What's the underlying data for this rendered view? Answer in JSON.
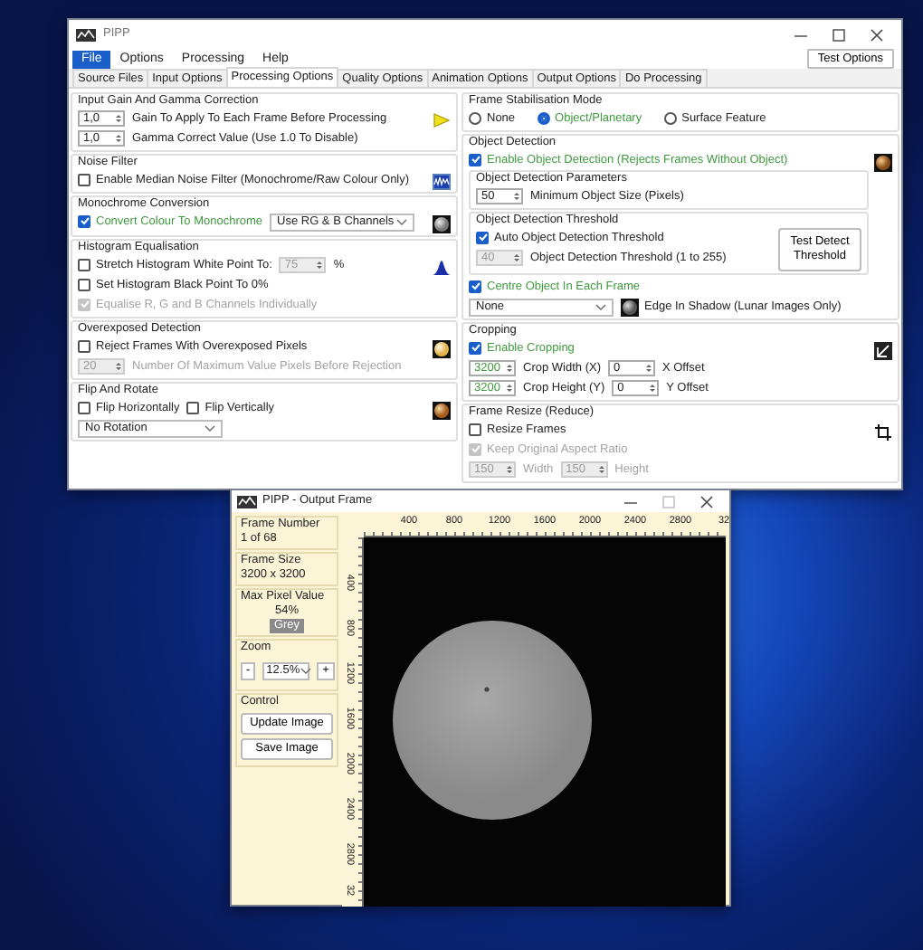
{
  "main_window": {
    "title": "PIPP",
    "menu": [
      {
        "label": "File",
        "selected": true
      },
      {
        "label": "Options",
        "selected": false
      },
      {
        "label": "Processing",
        "selected": false
      },
      {
        "label": "Help",
        "selected": false
      }
    ],
    "test_options_button": "Test Options",
    "tabs": [
      {
        "label": "Source Files",
        "selected": false
      },
      {
        "label": "Input Options",
        "selected": false
      },
      {
        "label": "Processing Options",
        "selected": true
      },
      {
        "label": "Quality Options",
        "selected": false
      },
      {
        "label": "Animation Options",
        "selected": false
      },
      {
        "label": "Output Options",
        "selected": false
      },
      {
        "label": "Do Processing",
        "selected": false
      }
    ],
    "left_sections": [
      {
        "title": "Input Gain And Gamma Correction",
        "rows": [
          {
            "kind": "line",
            "items": [
              {
                "kind": "spin",
                "value": "1,0",
                "disabled": false,
                "emphasized": false
              },
              {
                "kind": "text",
                "text": "Gain To Apply To Each Frame Before Processing",
                "disabled": false
              }
            ]
          },
          {
            "kind": "line",
            "items": [
              {
                "kind": "spin",
                "value": "1,0",
                "disabled": false,
                "emphasized": false
              },
              {
                "kind": "text",
                "text": "Gamma Correct Value (Use 1.0 To Disable)",
                "disabled": false
              }
            ]
          }
        ]
      },
      {
        "title": "Noise Filter",
        "rows": [
          {
            "kind": "line",
            "items": [
              {
                "kind": "checkbox",
                "label": "Enable Median Noise Filter (Monochrome/Raw Colour Only)",
                "checked": false,
                "disabled": false,
                "emphasized": false
              }
            ]
          }
        ]
      },
      {
        "title": "Monochrome Conversion",
        "rows": [
          {
            "kind": "line",
            "items": [
              {
                "kind": "checkbox",
                "label": "Convert Colour To Monochrome",
                "checked": true,
                "disabled": false,
                "emphasized": true
              },
              {
                "kind": "select",
                "value": "Use RG & B Channels"
              }
            ]
          }
        ]
      },
      {
        "title": "Histogram Equalisation",
        "rows": [
          {
            "kind": "line",
            "items": [
              {
                "kind": "checkbox",
                "label": "Stretch Histogram White Point To:",
                "checked": false,
                "disabled": false,
                "emphasized": false
              },
              {
                "kind": "spin",
                "value": "75",
                "disabled": true,
                "emphasized": false
              },
              {
                "kind": "text",
                "text": "%",
                "disabled": false
              }
            ]
          },
          {
            "kind": "line",
            "items": [
              {
                "kind": "checkbox",
                "label": "Set Histogram Black Point To 0%",
                "checked": false,
                "disabled": false,
                "emphasized": false
              }
            ]
          },
          {
            "kind": "line",
            "items": [
              {
                "kind": "checkbox",
                "label": "Equalise R, G and B Channels Individually",
                "checked": true,
                "disabled": true,
                "emphasized": false
              }
            ]
          }
        ]
      },
      {
        "title": "Overexposed Detection",
        "rows": [
          {
            "kind": "line",
            "items": [
              {
                "kind": "checkbox",
                "label": "Reject Frames With Overexposed Pixels",
                "checked": false,
                "disabled": false,
                "emphasized": false
              }
            ]
          },
          {
            "kind": "line",
            "items": [
              {
                "kind": "spin",
                "value": "20",
                "disabled": true,
                "emphasized": false
              },
              {
                "kind": "text",
                "text": "Number Of Maximum Value Pixels Before Rejection",
                "disabled": true
              }
            ]
          }
        ]
      },
      {
        "title": "Flip And Rotate",
        "rows": [
          {
            "kind": "line",
            "items": [
              {
                "kind": "checkbox",
                "label": "Flip Horizontally",
                "checked": false,
                "disabled": false,
                "emphasized": false
              },
              {
                "kind": "checkbox",
                "label": "Flip Vertically",
                "checked": false,
                "disabled": false,
                "emphasized": false
              }
            ]
          },
          {
            "kind": "line",
            "items": [
              {
                "kind": "select",
                "value": "No Rotation"
              }
            ]
          }
        ]
      }
    ],
    "right_sections": [
      {
        "title": "Frame Stabilisation Mode",
        "rows": [
          {
            "kind": "line",
            "items": [
              {
                "kind": "radio",
                "label": "None",
                "selected": false
              },
              {
                "kind": "radio",
                "label": "Object/Planetary",
                "selected": true
              },
              {
                "kind": "radio",
                "label": "Surface Feature",
                "selected": false
              }
            ]
          }
        ]
      },
      {
        "title": "Object Detection",
        "rows": [
          {
            "kind": "line",
            "items": [
              {
                "kind": "checkbox",
                "label": "Enable Object Detection (Rejects Frames Without Object)",
                "checked": true,
                "disabled": false,
                "emphasized": true
              }
            ]
          },
          {
            "kind": "group",
            "title": "Object Detection Parameters",
            "rows": [
              {
                "kind": "line",
                "items": [
                  {
                    "kind": "spin",
                    "value": "50",
                    "disabled": false,
                    "emphasized": false
                  },
                  {
                    "kind": "text",
                    "text": "Minimum Object Size (Pixels)",
                    "disabled": false
                  }
                ]
              }
            ]
          },
          {
            "kind": "group",
            "title": "Object Detection Threshold",
            "button": "Test Detect Threshold",
            "rows": [
              {
                "kind": "line",
                "items": [
                  {
                    "kind": "checkbox",
                    "label": "Auto Object Detection Threshold",
                    "checked": true,
                    "disabled": false,
                    "emphasized": false
                  }
                ]
              },
              {
                "kind": "line",
                "items": [
                  {
                    "kind": "spin",
                    "value": "40",
                    "disabled": true,
                    "emphasized": false
                  },
                  {
                    "kind": "text",
                    "text": "Object Detection Threshold (1 to 255)",
                    "disabled": false
                  }
                ]
              }
            ]
          },
          {
            "kind": "line",
            "items": [
              {
                "kind": "checkbox",
                "label": "Centre Object In Each Frame",
                "checked": true,
                "disabled": false,
                "emphasized": true
              }
            ]
          },
          {
            "kind": "line",
            "items": [
              {
                "kind": "select",
                "value": "None"
              },
              {
                "kind": "icon_text",
                "text": "Edge In Shadow (Lunar Images Only)"
              }
            ]
          }
        ]
      },
      {
        "title": "Cropping",
        "rows": [
          {
            "kind": "line",
            "items": [
              {
                "kind": "checkbox",
                "label": "Enable Cropping",
                "checked": true,
                "disabled": false,
                "emphasized": true
              }
            ]
          },
          {
            "kind": "line",
            "items": [
              {
                "kind": "spin",
                "value": "3200",
                "disabled": false,
                "emphasized": true
              },
              {
                "kind": "text",
                "text": "Crop Width (X)",
                "disabled": false
              },
              {
                "kind": "spin",
                "value": "0",
                "disabled": false,
                "emphasized": false
              },
              {
                "kind": "text",
                "text": "X Offset",
                "disabled": false
              }
            ]
          },
          {
            "kind": "line",
            "items": [
              {
                "kind": "spin",
                "value": "3200",
                "disabled": false,
                "emphasized": true
              },
              {
                "kind": "text",
                "text": "Crop Height (Y)",
                "disabled": false
              },
              {
                "kind": "spin",
                "value": "0",
                "disabled": false,
                "emphasized": false
              },
              {
                "kind": "text",
                "text": "Y Offset",
                "disabled": false
              }
            ]
          }
        ]
      },
      {
        "title": "Frame Resize (Reduce)",
        "rows": [
          {
            "kind": "line",
            "items": [
              {
                "kind": "checkbox",
                "label": "Resize Frames",
                "checked": false,
                "disabled": false,
                "emphasized": false
              }
            ]
          },
          {
            "kind": "line",
            "items": [
              {
                "kind": "checkbox",
                "label": "Keep Original Aspect Ratio",
                "checked": true,
                "disabled": true,
                "emphasized": false
              }
            ]
          },
          {
            "kind": "line",
            "items": [
              {
                "kind": "spin",
                "value": "150",
                "disabled": true,
                "emphasized": false
              },
              {
                "kind": "text",
                "text": "Width",
                "disabled": true
              },
              {
                "kind": "spin",
                "value": "150",
                "disabled": true,
                "emphasized": false
              },
              {
                "kind": "text",
                "text": "Height",
                "disabled": true
              }
            ]
          }
        ]
      }
    ]
  },
  "output_window": {
    "title": "PIPP - Output Frame",
    "info": [
      {
        "title": "Frame Number",
        "value": "1 of 68"
      },
      {
        "title": "Frame Size",
        "value": "3200 x 3200"
      },
      {
        "title": "Max Pixel Value",
        "value": "54%",
        "badge": "Grey"
      }
    ],
    "zoom": {
      "title": "Zoom",
      "minus": "-",
      "value": "12.5%",
      "plus": "+"
    },
    "control": {
      "title": "Control",
      "buttons": [
        "Update Image",
        "Save Image"
      ]
    },
    "top_ruler": [
      "400",
      "800",
      "1200",
      "1600",
      "2000",
      "2400",
      "2800",
      "32"
    ],
    "left_ruler": [
      "400",
      "800",
      "1200",
      "1600",
      "2000",
      "2400",
      "2800",
      "32"
    ]
  }
}
